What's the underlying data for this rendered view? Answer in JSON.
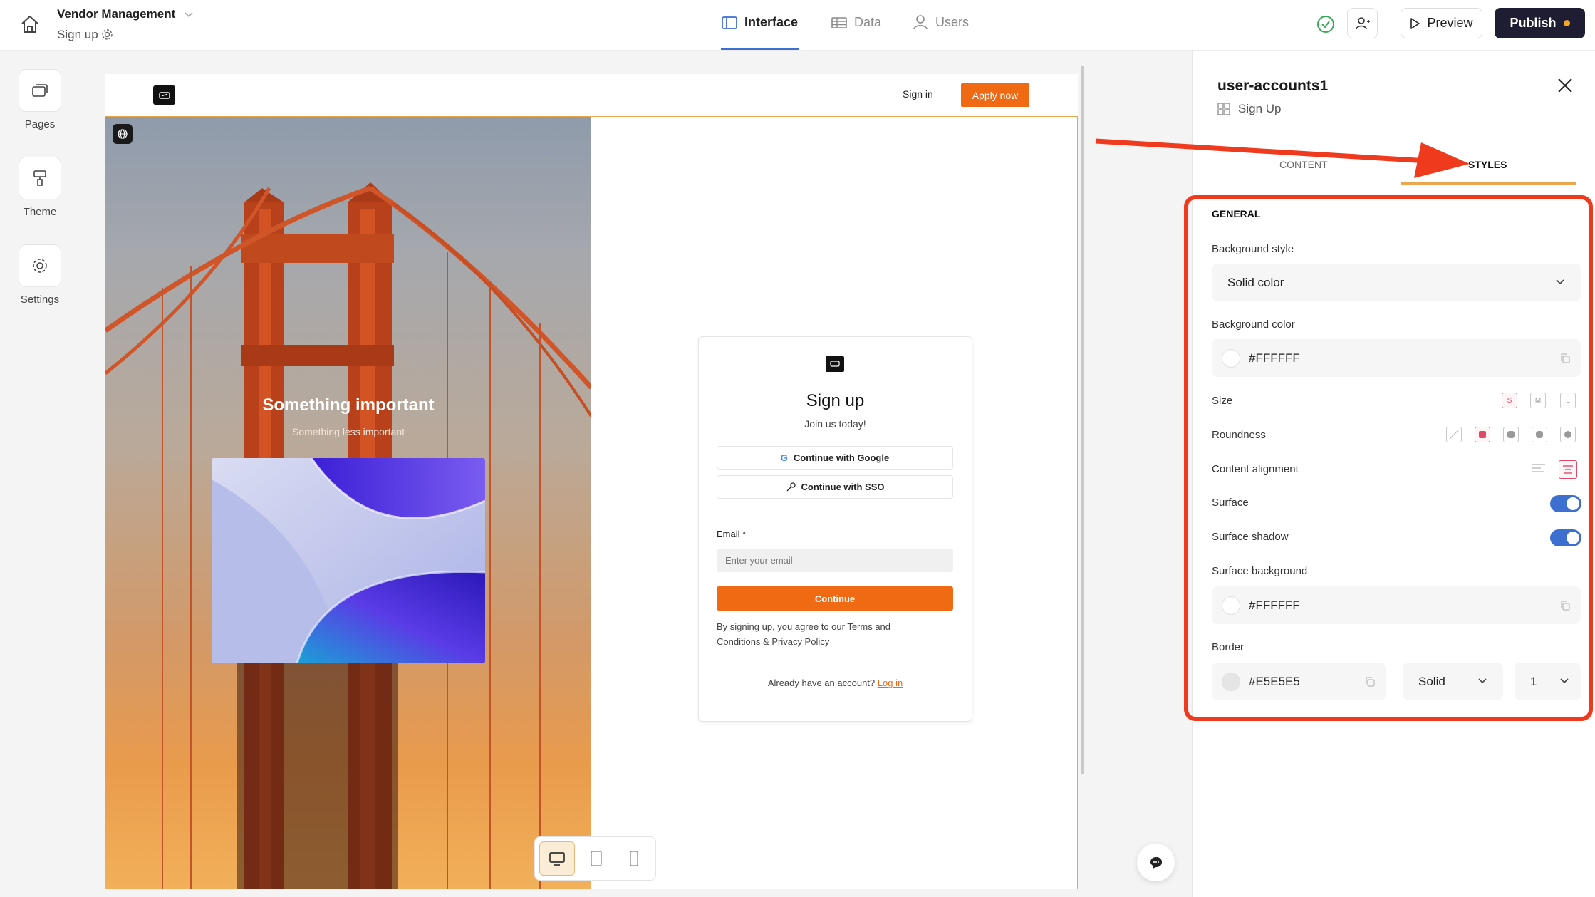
{
  "header": {
    "app_title": "Vendor Management",
    "page_name": "Sign up",
    "tabs": [
      {
        "label": "Interface",
        "icon": "layout-icon",
        "active": true
      },
      {
        "label": "Data",
        "icon": "table-icon",
        "active": false
      },
      {
        "label": "Users",
        "icon": "user-icon",
        "active": false
      }
    ],
    "preview_label": "Preview",
    "publish_label": "Publish"
  },
  "sidebar": {
    "items": [
      {
        "label": "Pages",
        "icon": "pages-icon"
      },
      {
        "label": "Theme",
        "icon": "paint-roller-icon"
      },
      {
        "label": "Settings",
        "icon": "gear-icon"
      }
    ]
  },
  "canvas": {
    "nav": {
      "sign_in": "Sign in",
      "apply_now": "Apply now"
    },
    "hero": {
      "title": "Something important",
      "subtitle": "Something less important"
    },
    "card": {
      "title": "Sign up",
      "subtitle": "Join us today!",
      "google_label": "Continue with Google",
      "sso_label": "Continue with SSO",
      "email_label": "Email *",
      "email_placeholder": "Enter your email",
      "continue_label": "Continue",
      "terms_text": "By signing up, you agree to our Terms and Conditions & Privacy Policy",
      "login_prompt": "Already have an account?",
      "login_link": "Log in"
    }
  },
  "panel": {
    "title": "user-accounts1",
    "subtitle": "Sign Up",
    "tabs": [
      {
        "label": "CONTENT",
        "active": false
      },
      {
        "label": "STYLES",
        "active": true
      }
    ],
    "section_title": "GENERAL",
    "background_style": {
      "label": "Background style",
      "value": "Solid color"
    },
    "background_color": {
      "label": "Background color",
      "value": "#FFFFFF"
    },
    "size": {
      "label": "Size",
      "options": [
        "S",
        "M",
        "L"
      ],
      "selected": "S"
    },
    "roundness": {
      "label": "Roundness",
      "selected_index": 1
    },
    "content_alignment": {
      "label": "Content alignment",
      "selected": "center"
    },
    "surface": {
      "label": "Surface",
      "on": true
    },
    "surface_shadow": {
      "label": "Surface shadow",
      "on": true
    },
    "surface_background": {
      "label": "Surface background",
      "value": "#FFFFFF"
    },
    "border": {
      "label": "Border",
      "color": "#E5E5E5",
      "style": "Solid",
      "width": "1"
    }
  },
  "colors": {
    "accent_orange": "#EF6A13",
    "toggle_blue": "#3D6FD1",
    "annotation_red": "#F03A1E",
    "publish_bg": "#1E1D33"
  }
}
